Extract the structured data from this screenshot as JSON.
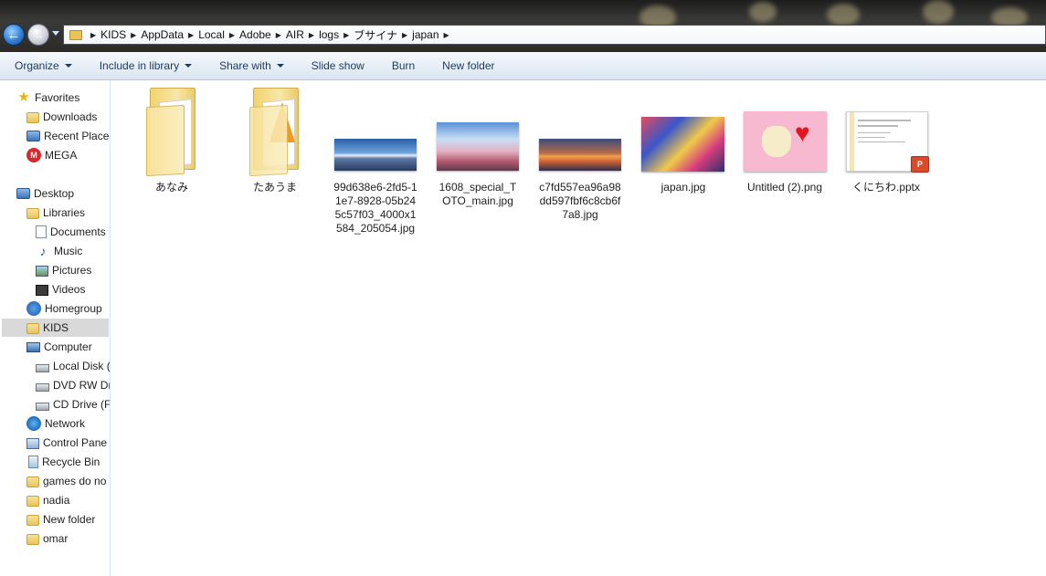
{
  "address": {
    "crumbs": [
      "KIDS",
      "AppData",
      "Local",
      "Adobe",
      "AIR",
      "logs",
      "ブサイナ",
      "japan"
    ]
  },
  "toolbar": {
    "organize": "Organize",
    "include_in_library": "Include in library",
    "share_with": "Share with",
    "slide_show": "Slide show",
    "burn": "Burn",
    "new_folder": "New folder"
  },
  "sidebar": {
    "items": [
      {
        "label": "Favorites",
        "icon": "star-icon"
      },
      {
        "label": "Downloads",
        "icon": "downloads-folder-icon"
      },
      {
        "label": "Recent Places",
        "icon": "recent-places-icon"
      },
      {
        "label": "MEGA",
        "icon": "mega-icon"
      },
      {
        "label": "Desktop",
        "icon": "desktop-icon"
      },
      {
        "label": "Libraries",
        "icon": "libraries-icon"
      },
      {
        "label": "Documents",
        "icon": "documents-icon"
      },
      {
        "label": "Music",
        "icon": "music-icon"
      },
      {
        "label": "Pictures",
        "icon": "pictures-icon"
      },
      {
        "label": "Videos",
        "icon": "videos-icon"
      },
      {
        "label": "Homegroup",
        "icon": "homegroup-icon"
      },
      {
        "label": "KIDS",
        "icon": "user-folder-icon"
      },
      {
        "label": "Computer",
        "icon": "computer-icon"
      },
      {
        "label": "Local Disk (",
        "icon": "local-disk-icon"
      },
      {
        "label": "DVD RW Dr",
        "icon": "dvd-drive-icon"
      },
      {
        "label": "CD Drive (F",
        "icon": "cd-drive-icon"
      },
      {
        "label": "Network",
        "icon": "network-icon"
      },
      {
        "label": "Control Pane",
        "icon": "control-panel-icon"
      },
      {
        "label": "Recycle Bin",
        "icon": "recycle-bin-icon"
      },
      {
        "label": "games do no",
        "icon": "folder-icon"
      },
      {
        "label": "nadia",
        "icon": "folder-icon"
      },
      {
        "label": "New folder",
        "icon": "folder-icon"
      },
      {
        "label": "omar",
        "icon": "folder-icon"
      }
    ],
    "selected": "KIDS"
  },
  "files": [
    {
      "name": "あなみ",
      "type": "folder"
    },
    {
      "name": "たあうま",
      "type": "folder"
    },
    {
      "name": "99d638e6-2fd5-11e7-8928-05b245c57f03_4000x1584_205054.jpg",
      "type": "image"
    },
    {
      "name": "1608_special_TOTO_main.jpg",
      "type": "image"
    },
    {
      "name": "c7fd557ea96a98dd597fbf6c8cb6f7a8.jpg",
      "type": "image"
    },
    {
      "name": "japan.jpg",
      "type": "image"
    },
    {
      "name": "Untitled (2).png",
      "type": "image"
    },
    {
      "name": "くにちわ.pptx",
      "type": "presentation"
    }
  ]
}
